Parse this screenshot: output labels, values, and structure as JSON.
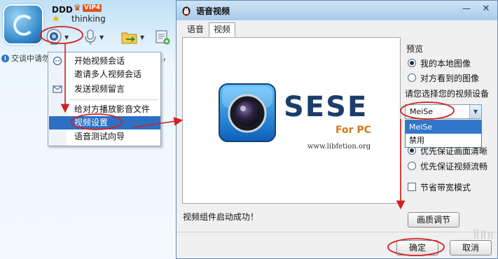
{
  "chat": {
    "buddy_name": "DDD",
    "vip_label": "VIP4",
    "status": "thinking",
    "info_text": "交谈中请勿",
    "info_tail": "，",
    "video_menu": {
      "items": [
        {
          "label": "开始视频会话",
          "icon": "video-chat-icon"
        },
        {
          "label": "邀请多人视频会话",
          "icon": ""
        },
        {
          "label": "发送视频留言",
          "icon": "envelope-icon"
        },
        {
          "label": "给对方播放影音文件",
          "icon": ""
        },
        {
          "label": "视频设置",
          "icon": ""
        },
        {
          "label": "语音测试向导",
          "icon": ""
        }
      ],
      "selected": "视频设置"
    }
  },
  "dialog": {
    "title": "语音视频",
    "tabs": [
      {
        "label": "语音",
        "active": false
      },
      {
        "label": "视频",
        "active": true
      }
    ],
    "preview": {
      "logo_title": "SESE",
      "logo_subtitle": "For PC",
      "logo_url": "www.libfetion.org"
    },
    "status_text": "视频组件启动成功！",
    "preview_section_label": "预览",
    "preview_options": [
      "我的本地图像",
      "对方看到的图像"
    ],
    "preview_selected": 0,
    "device_label": "请您选择您的视频设备",
    "device_value": "MeiSe",
    "device_options": [
      "MeiSe",
      "禁用"
    ],
    "quality_options": [
      "优先保证画面清晰",
      "优先保证视频流畅"
    ],
    "quality_selected": 0,
    "bandwidth_label": "节省带宽模式",
    "bandwidth_checked": false,
    "buttons": {
      "quality": "画质调节",
      "ok": "确定",
      "cancel": "取消"
    }
  },
  "colors": {
    "annotation": "#d42020",
    "menu_highlight": "#2c6fc3",
    "titlebar": "#a9cbe9"
  }
}
